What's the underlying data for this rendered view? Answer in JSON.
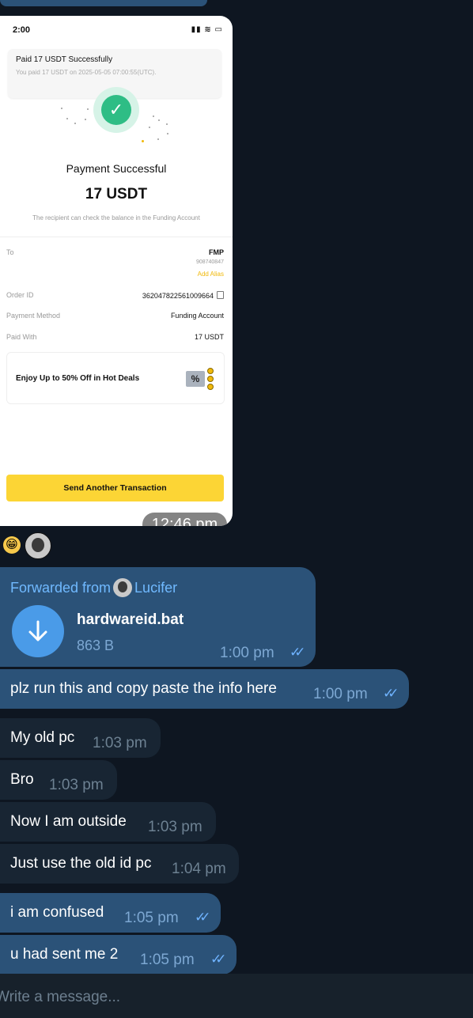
{
  "screenshot": {
    "status_time": "2:00",
    "status_icons": "▮▮ ≋ ▭",
    "notification": {
      "title": "Paid 17 USDT Successfully",
      "subtitle": "You paid 17 USDT on 2025-05-05 07:00:55(UTC)."
    },
    "payment_title": "Payment Successful",
    "amount": "17 USDT",
    "note": "The recipient can check the balance in the Funding Account",
    "details": {
      "to_label": "To",
      "to_name": "FMP",
      "to_id": "908740847",
      "add_alias": "Add Alias",
      "order_label": "Order ID",
      "order_value": "362047822561009664",
      "method_label": "Payment Method",
      "method_value": "Funding Account",
      "paid_label": "Paid With",
      "paid_value": "17 USDT"
    },
    "deal_text": "Enjoy Up to 50% Off in Hot Deals",
    "deal_icon_text": "%",
    "send_button": "Send Another Transaction",
    "message_time": "12:46 pm"
  },
  "reactions": {
    "emoji": "😁"
  },
  "messages": [
    {
      "id": "forward",
      "forwarded_prefix": "Forwarded from",
      "forwarded_name": "Lucifer",
      "file_name": "hardwareid.bat",
      "file_size": "863 B",
      "time": "1:00 pm",
      "outgoing": true
    },
    {
      "id": "m1",
      "text": "plz run this and copy paste the info here",
      "time": "1:00 pm",
      "outgoing": true
    },
    {
      "id": "m2",
      "text": "My old pc",
      "time": "1:03 pm",
      "outgoing": false
    },
    {
      "id": "m3",
      "text": "Bro",
      "time": "1:03 pm",
      "outgoing": false
    },
    {
      "id": "m4",
      "text": "Now I am outside",
      "time": "1:03 pm",
      "outgoing": false
    },
    {
      "id": "m5",
      "text": "Just use the old id pc",
      "time": "1:04 pm",
      "outgoing": false
    },
    {
      "id": "m6",
      "text": "i am confused",
      "time": "1:05 pm",
      "outgoing": true
    },
    {
      "id": "m7",
      "text": "u had sent me 2",
      "time": "1:05 pm",
      "outgoing": true
    }
  ],
  "composer": {
    "placeholder": "Write a message..."
  },
  "colors": {
    "outgoing": "#2b5278",
    "incoming": "#182533",
    "background": "#0e1621",
    "accent": "#f0b90b",
    "check": "#2ebd85"
  }
}
